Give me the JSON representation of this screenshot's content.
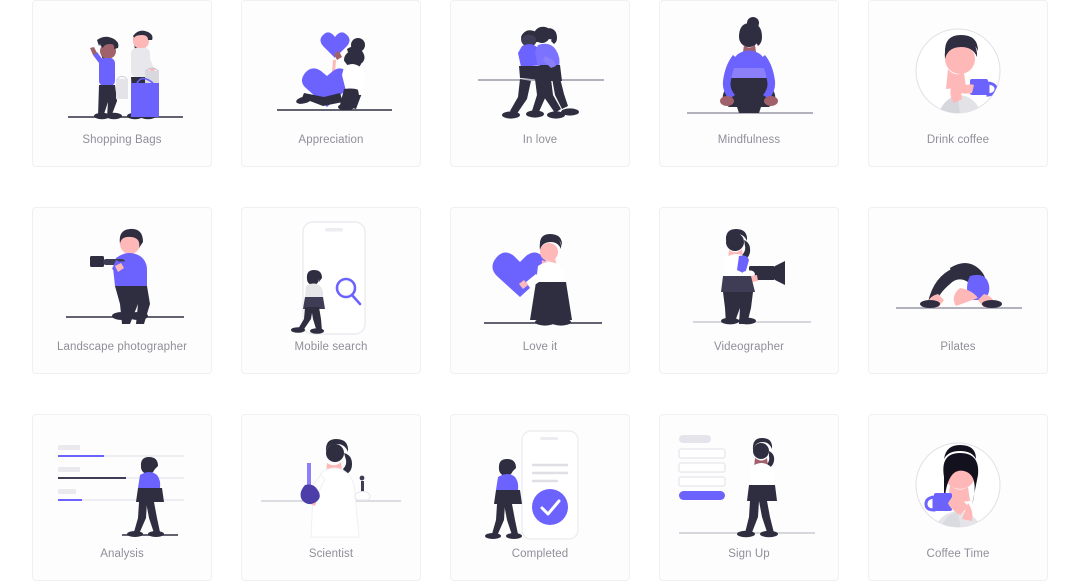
{
  "gallery": {
    "columns": 5,
    "colors": {
      "accent_purple": "#6c63ff",
      "accent_purple_light": "#8b80f9",
      "dark_navy": "#2f2e41",
      "skin_light": "#ffb8b8",
      "skin_dark": "#a0616a",
      "garment_grey": "#e6e6e6",
      "ground_line": "#3f3d56",
      "card_background": "#fdfdfe",
      "card_border": "#f0f0f3",
      "caption_text": "#8f8f98",
      "page_background": "#ffffff"
    },
    "cards": [
      {
        "label": "Shopping Bags",
        "icon": "shopping-bags-illustration"
      },
      {
        "label": "Appreciation",
        "icon": "appreciation-illustration"
      },
      {
        "label": "In love",
        "icon": "in-love-illustration"
      },
      {
        "label": "Mindfulness",
        "icon": "mindfulness-illustration"
      },
      {
        "label": "Drink coffee",
        "icon": "drink-coffee-illustration"
      },
      {
        "label": "Landscape photographer",
        "icon": "landscape-photographer-illustration"
      },
      {
        "label": "Mobile search",
        "icon": "mobile-search-illustration"
      },
      {
        "label": "Love it",
        "icon": "love-it-illustration"
      },
      {
        "label": "Videographer",
        "icon": "videographer-illustration"
      },
      {
        "label": "Pilates",
        "icon": "pilates-illustration"
      },
      {
        "label": "Analysis",
        "icon": "analysis-illustration"
      },
      {
        "label": "Scientist",
        "icon": "scientist-illustration"
      },
      {
        "label": "Completed",
        "icon": "completed-illustration"
      },
      {
        "label": "Sign Up",
        "icon": "sign-up-illustration"
      },
      {
        "label": "Coffee Time",
        "icon": "coffee-time-illustration"
      }
    ]
  }
}
